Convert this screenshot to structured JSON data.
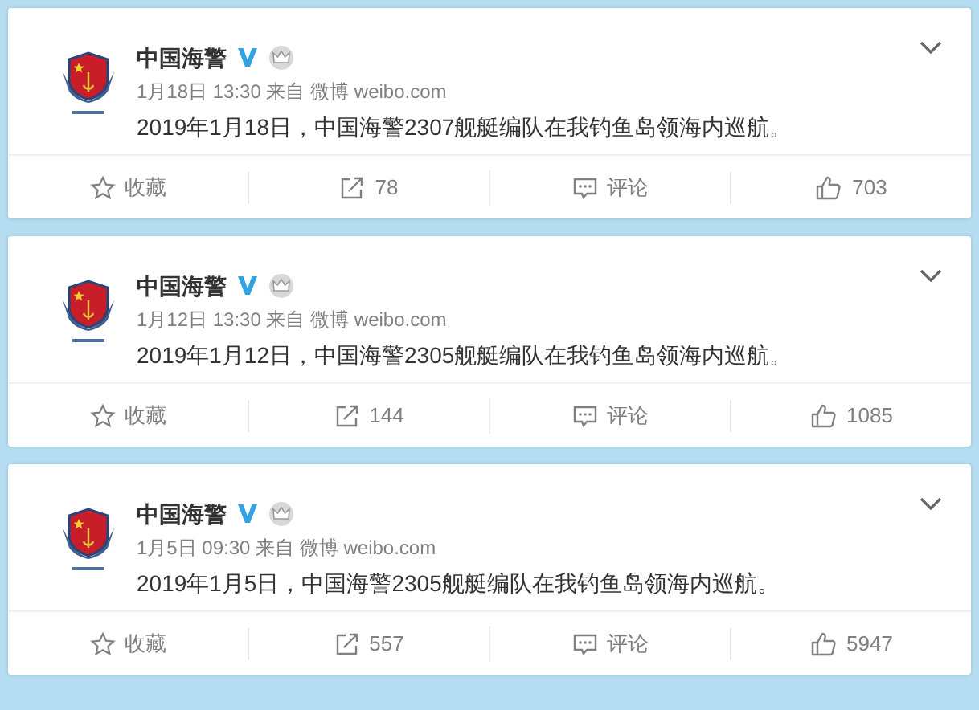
{
  "posts": [
    {
      "author": "中国海警",
      "verified": true,
      "member": true,
      "time": "1月18日 13:30",
      "source_prefix": "来自",
      "source": "微博 weibo.com",
      "text": "2019年1月18日，中国海警2307舰艇编队在我钓鱼岛领海内巡航。",
      "actions": [
        {
          "kind": "favorite",
          "label": "收藏"
        },
        {
          "kind": "repost",
          "label": "78"
        },
        {
          "kind": "comment",
          "label": "评论"
        },
        {
          "kind": "like",
          "label": "703"
        }
      ]
    },
    {
      "author": "中国海警",
      "verified": true,
      "member": true,
      "time": "1月12日 13:30",
      "source_prefix": "来自",
      "source": "微博 weibo.com",
      "text": "2019年1月12日，中国海警2305舰艇编队在我钓鱼岛领海内巡航。",
      "actions": [
        {
          "kind": "favorite",
          "label": "收藏"
        },
        {
          "kind": "repost",
          "label": "144"
        },
        {
          "kind": "comment",
          "label": "评论"
        },
        {
          "kind": "like",
          "label": "1085"
        }
      ]
    },
    {
      "author": "中国海警",
      "verified": true,
      "member": true,
      "time": "1月5日 09:30",
      "source_prefix": "来自",
      "source": "微博 weibo.com",
      "text": "2019年1月5日，中国海警2305舰艇编队在我钓鱼岛领海内巡航。",
      "actions": [
        {
          "kind": "favorite",
          "label": "收藏"
        },
        {
          "kind": "repost",
          "label": "557"
        },
        {
          "kind": "comment",
          "label": "评论"
        },
        {
          "kind": "like",
          "label": "5947"
        }
      ]
    }
  ]
}
